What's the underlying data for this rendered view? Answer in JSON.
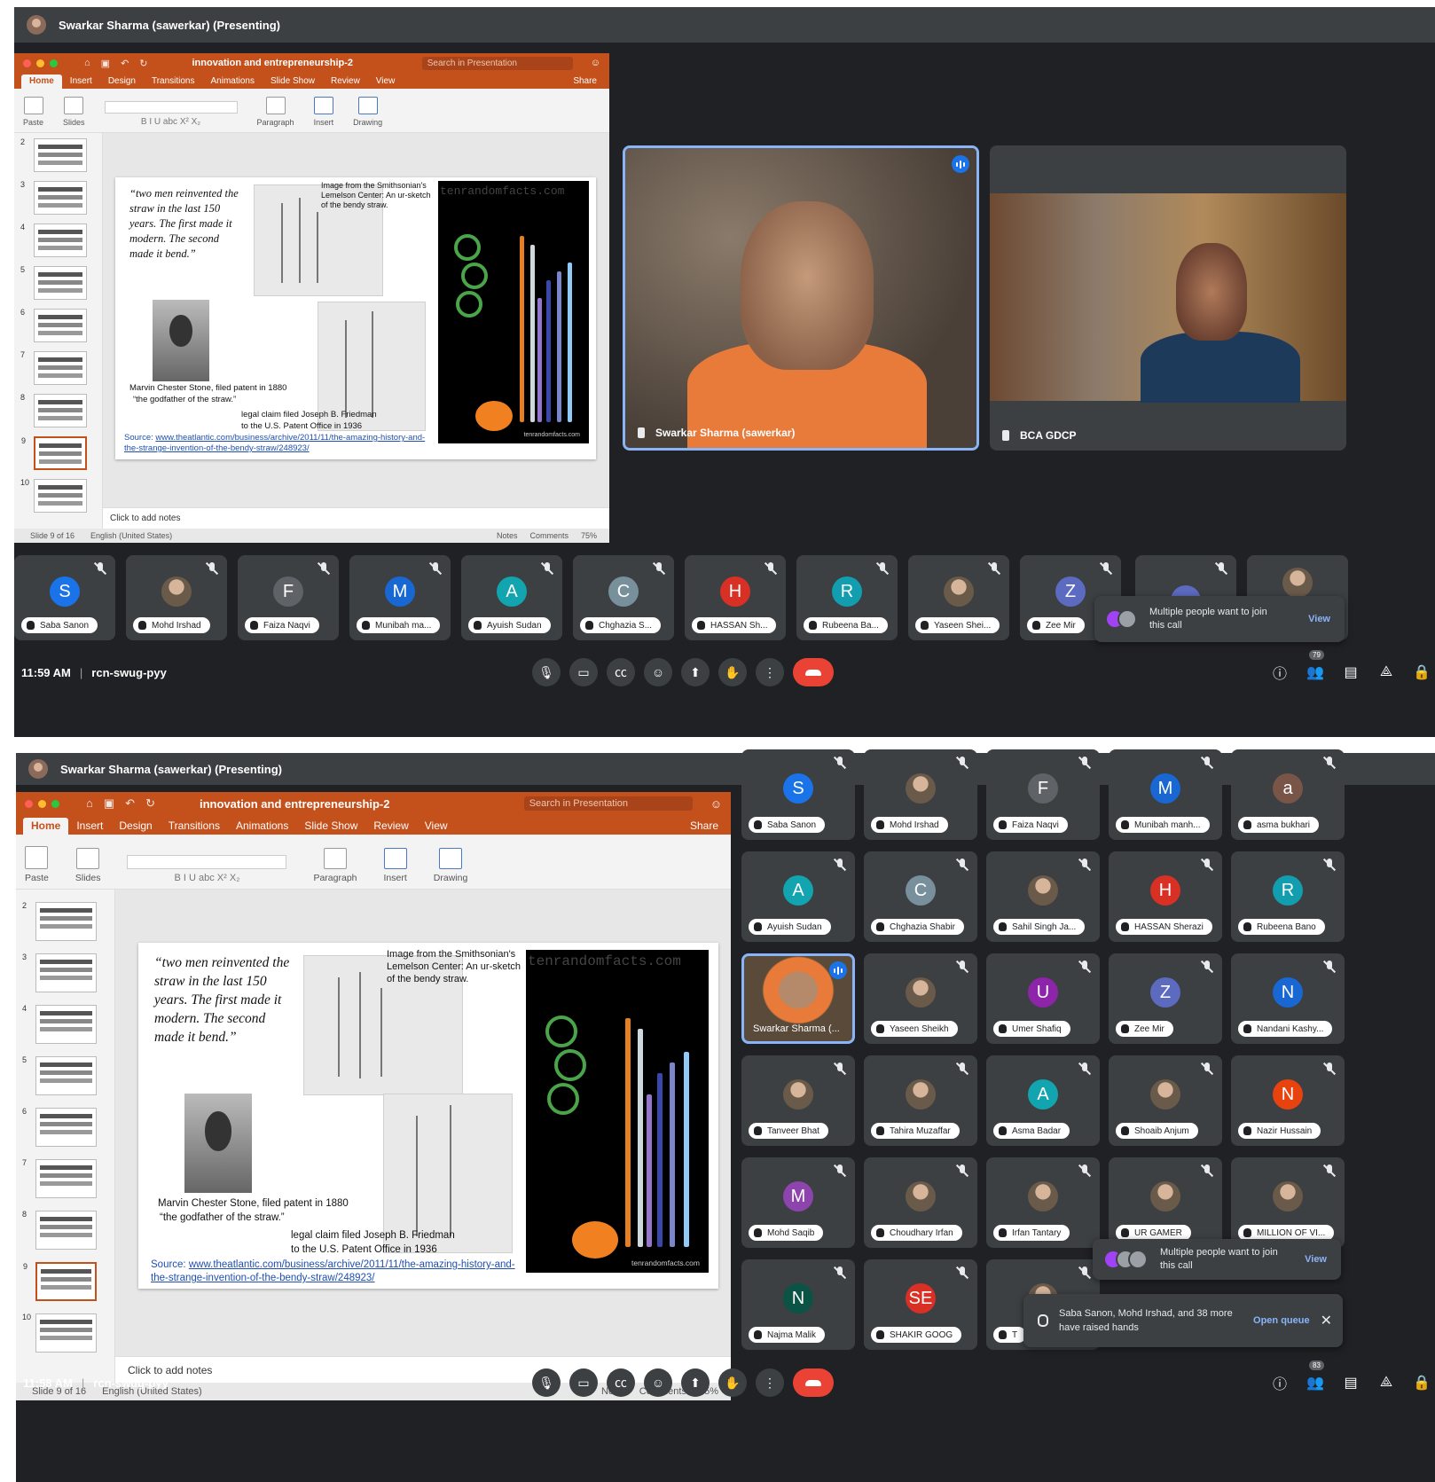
{
  "screens": [
    {
      "presenter_bar": "Swarkar Sharma (sawerkar) (Presenting)",
      "ppt": {
        "doc_title": "innovation and entrepreneurship-2",
        "search_placeholder": "Search in Presentation",
        "share": "Share",
        "tabs": [
          "Home",
          "Insert",
          "Design",
          "Transitions",
          "Animations",
          "Slide Show",
          "Review",
          "View"
        ],
        "ribbon": {
          "paste": "Paste",
          "slides": "Slides",
          "paragraph": "Paragraph",
          "insert": "Insert",
          "drawing": "Drawing"
        },
        "slide_numbers": [
          "2",
          "3",
          "4",
          "5",
          "6",
          "7",
          "8",
          "9",
          "10"
        ],
        "notes_placeholder": "Click to add notes",
        "status": {
          "slide": "Slide 9 of 16",
          "lang": "English (United States)",
          "notes": "Notes",
          "comments": "Comments",
          "zoom": "75%"
        }
      },
      "main_tiles": [
        {
          "name": "Swarkar Sharma (sawerkar)"
        },
        {
          "name": "BCA GDCP"
        }
      ],
      "participants": [
        {
          "initial": "S",
          "name": "Saba Sanon",
          "color": "#1a73e8"
        },
        {
          "initial": "",
          "name": "Mohd Irshad",
          "color": ""
        },
        {
          "initial": "F",
          "name": "Faiza Naqvi",
          "color": "#5f6368"
        },
        {
          "initial": "M",
          "name": "Munibah ma...",
          "color": "#1967d2"
        },
        {
          "initial": "A",
          "name": "Ayuish Sudan",
          "color": "#12a4af"
        },
        {
          "initial": "C",
          "name": "Chghazia S...",
          "color": "#78909c"
        },
        {
          "initial": "H",
          "name": "HASSAN Sh...",
          "color": "#d93025"
        },
        {
          "initial": "R",
          "name": "Rubeena Ba...",
          "color": "#129eaf"
        },
        {
          "initial": "",
          "name": "Yaseen Shei...",
          "color": ""
        },
        {
          "initial": "Z",
          "name": "Zee Mir",
          "color": "#5c6bc0"
        }
      ],
      "join_toast": {
        "text": "Multiple people want to join this call",
        "action": "View"
      },
      "time": "11:59 AM",
      "meeting_code": "rcn-swug-pyy",
      "people_count": "79"
    },
    {
      "presenter_bar": "Swarkar Sharma (sawerkar) (Presenting)",
      "ppt": {
        "doc_title": "innovation and entrepreneurship-2",
        "search_placeholder": "Search in Presentation",
        "share": "Share",
        "tabs": [
          "Home",
          "Insert",
          "Design",
          "Transitions",
          "Animations",
          "Slide Show",
          "Review",
          "View"
        ],
        "ribbon": {
          "paste": "Paste",
          "slides": "Slides",
          "paragraph": "Paragraph",
          "insert": "Insert",
          "drawing": "Drawing"
        },
        "slide_numbers": [
          "2",
          "3",
          "4",
          "5",
          "6",
          "7",
          "8",
          "9",
          "10"
        ],
        "notes_placeholder": "Click to add notes",
        "status": {
          "slide": "Slide 9 of 16",
          "lang": "English (United States)",
          "notes": "Notes",
          "comments": "Comments",
          "zoom": "75%"
        }
      },
      "participants": [
        {
          "initial": "S",
          "name": "Saba Sanon",
          "color": "#1a73e8"
        },
        {
          "initial": "",
          "name": "Mohd Irshad",
          "color": ""
        },
        {
          "initial": "F",
          "name": "Faiza Naqvi",
          "color": "#5f6368"
        },
        {
          "initial": "M",
          "name": "Munibah manh...",
          "color": "#1967d2"
        },
        {
          "initial": "a",
          "name": "asma bukhari",
          "color": "#795548"
        },
        {
          "initial": "A",
          "name": "Ayuish Sudan",
          "color": "#12a4af"
        },
        {
          "initial": "C",
          "name": "Chghazia Shabir",
          "color": "#78909c"
        },
        {
          "initial": "",
          "name": "Sahil Singh Ja...",
          "color": ""
        },
        {
          "initial": "H",
          "name": "HASSAN Sherazi",
          "color": "#d93025"
        },
        {
          "initial": "R",
          "name": "Rubeena Bano",
          "color": "#129eaf"
        },
        {
          "initial": "",
          "name": "Swarkar Sharma (...",
          "color": "",
          "video": true
        },
        {
          "initial": "",
          "name": "Yaseen Sheikh",
          "color": ""
        },
        {
          "initial": "U",
          "name": "Umer Shafiq",
          "color": "#8e24aa"
        },
        {
          "initial": "Z",
          "name": "Zee Mir",
          "color": "#5c6bc0"
        },
        {
          "initial": "N",
          "name": "Nandani Kashy...",
          "color": "#1967d2"
        },
        {
          "initial": "",
          "name": "Tanveer Bhat",
          "color": ""
        },
        {
          "initial": "",
          "name": "Tahira Muzaffar",
          "color": ""
        },
        {
          "initial": "A",
          "name": "Asma Badar",
          "color": "#12a4af"
        },
        {
          "initial": "",
          "name": "Shoaib Anjum",
          "color": ""
        },
        {
          "initial": "N",
          "name": "Nazir Hussain",
          "color": "#e8430f"
        },
        {
          "initial": "M",
          "name": "Mohd Saqib",
          "color": "#8e44ad"
        },
        {
          "initial": "",
          "name": "Choudhary Irfan",
          "color": ""
        },
        {
          "initial": "",
          "name": "Irfan Tantary",
          "color": ""
        },
        {
          "initial": "",
          "name": "UR GAMER",
          "color": ""
        },
        {
          "initial": "",
          "name": "MILLION OF VI...",
          "color": ""
        },
        {
          "initial": "N",
          "name": "Najma Malik",
          "color": "#0b5345"
        },
        {
          "initial": "SE",
          "name": "SHAKIR GOOG",
          "color": "#d93025"
        },
        {
          "initial": "",
          "name": "T",
          "color": ""
        }
      ],
      "join_toast": {
        "text": "Multiple people want to join this call",
        "action": "View"
      },
      "hands_toast": {
        "text": "Saba Sanon, Mohd Irshad, and 38 more have raised hands",
        "action": "Open queue"
      },
      "time": "11:58 AM",
      "meeting_code": "rcn-swug-pyy",
      "people_count": "83"
    }
  ],
  "slide": {
    "quote": "“two men reinvented the straw in the last 150 years. The first made it modern. The second made it bend.”",
    "image_caption": "Image from the Smithsonian's Lemelson Center: An ur-sketch of the bendy straw.",
    "watermark": "tenrandomfacts.com",
    "credit": "tenrandomfacts.com",
    "stone_caption_1": "Marvin Chester Stone, filed patent in 1880",
    "stone_caption_2": "“the godfather of the straw.”",
    "friedman_caption_1": "legal claim filed Joseph B. Friedman",
    "friedman_caption_2": "to the U.S. Patent Office in 1936",
    "source_label": "Source:",
    "source_url": "www.theatlantic.com/business/archive/2011/11/the-amazing-history-and-the-strange-invention-of-the-bendy-straw/248923/"
  }
}
